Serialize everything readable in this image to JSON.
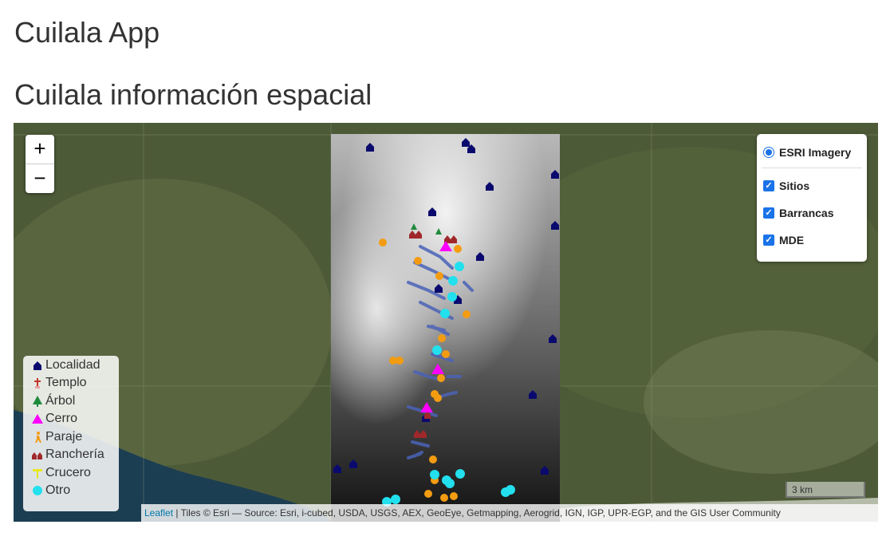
{
  "app_title": "Cuilala App",
  "section_title": "Cuilala información espacial",
  "zoom": {
    "in_label": "+",
    "out_label": "−"
  },
  "layers_control": {
    "base_layer": "ESRI Imagery",
    "overlays": [
      {
        "label": "Sitios",
        "checked": true
      },
      {
        "label": "Barrancas",
        "checked": true
      },
      {
        "label": "MDE",
        "checked": true
      }
    ]
  },
  "legend": {
    "items": [
      {
        "label": "Localidad",
        "icon": "house-icon",
        "color": "#0a0a6e"
      },
      {
        "label": "Templo",
        "icon": "cross-icon",
        "color": "#c0392b"
      },
      {
        "label": "Árbol",
        "icon": "tree-icon",
        "color": "#1e8a3c"
      },
      {
        "label": "Cerro",
        "icon": "triangle-icon",
        "color": "#ff00ff"
      },
      {
        "label": "Paraje",
        "icon": "hiker-icon",
        "color": "#f39c12"
      },
      {
        "label": "Ranchería",
        "icon": "houses-icon",
        "color": "#a0282a"
      },
      {
        "label": "Crucero",
        "icon": "crossroad-icon",
        "color": "#e8e81e"
      },
      {
        "label": "Otro",
        "icon": "circle-icon",
        "color": "#22e0ee"
      }
    ]
  },
  "scale_label": "3 km",
  "attribution": {
    "link_text": "Leaflet",
    "text": " | Tiles © Esri — Source: Esri, i-cubed, USDA, USGS, AEX, GeoEye, Getmapping, Aerogrid, IGN, IGP, UPR-EGP, and the GIS User Community"
  }
}
